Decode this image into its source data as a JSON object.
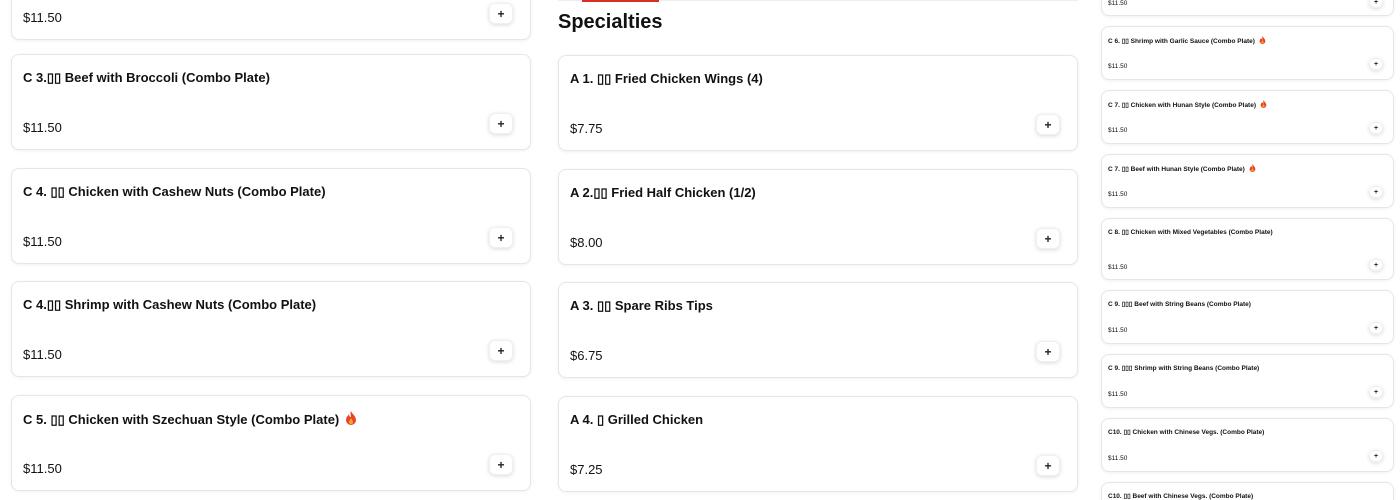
{
  "left_column": {
    "top_partial": {
      "price": "$11.50"
    },
    "items": [
      {
        "name": "C 3.▯▯ Beef with Broccoli (Combo Plate)",
        "price": "$11.50",
        "spicy": false
      },
      {
        "name": "C 4. ▯▯ Chicken with Cashew Nuts (Combo Plate)",
        "price": "$11.50",
        "spicy": false
      },
      {
        "name": "C 4.▯▯ Shrimp with Cashew Nuts (Combo Plate)",
        "price": "$11.50",
        "spicy": false
      },
      {
        "name": "C 5. ▯▯ Chicken with Szechuan Style (Combo Plate)",
        "price": "$11.50",
        "spicy": true
      }
    ]
  },
  "middle_column": {
    "section_title": "Specialties",
    "items": [
      {
        "name": "A 1. ▯▯ Fried Chicken Wings (4)",
        "price": "$7.75"
      },
      {
        "name": "A 2.▯▯ Fried Half Chicken (1/2)",
        "price": "$8.00"
      },
      {
        "name": "A 3. ▯▯ Spare Ribs Tips",
        "price": "$6.75"
      },
      {
        "name": "A 4. ▯ Grilled Chicken",
        "price": "$7.25"
      }
    ]
  },
  "right_column": {
    "top_partial": {
      "price": "$11.50"
    },
    "items": [
      {
        "name": "C 6. ▯▯ Shrimp with Garlic Sauce (Combo Plate)",
        "price": "$11.50",
        "spicy": true
      },
      {
        "name": "C 7. ▯▯ Chicken with Hunan Style (Combo Plate)",
        "price": "$11.50",
        "spicy": true
      },
      {
        "name": "C 7. ▯▯ Beef with Hunan Style (Combo Plate)",
        "price": "$11.50",
        "spicy": true
      },
      {
        "name": "C 8. ▯▯ Chicken with Mixed Vegetables (Combo Plate)",
        "price": "$11.50",
        "spicy": false
      },
      {
        "name": "C 9. ▯▯▯ Beef with String Beans (Combo Plate)",
        "price": "$11.50",
        "spicy": false
      },
      {
        "name": "C 9. ▯▯▯ Shrimp with String Beans (Combo Plate)",
        "price": "$11.50",
        "spicy": false
      },
      {
        "name": "C10. ▯▯ Chicken with Chinese Vegs. (Combo Plate)",
        "price": "$11.50",
        "spicy": false
      },
      {
        "name": "C10. ▯▯ Beef with Chinese Vegs. (Combo Plate)",
        "price": "",
        "spicy": false
      }
    ]
  },
  "icons": {
    "add": "plus-icon",
    "spicy": "fire-icon"
  },
  "add_button_glyph": "+",
  "colors": {
    "accent": "#d93025",
    "spicy_outer": "#e8442b",
    "spicy_inner": "#f9a825"
  }
}
